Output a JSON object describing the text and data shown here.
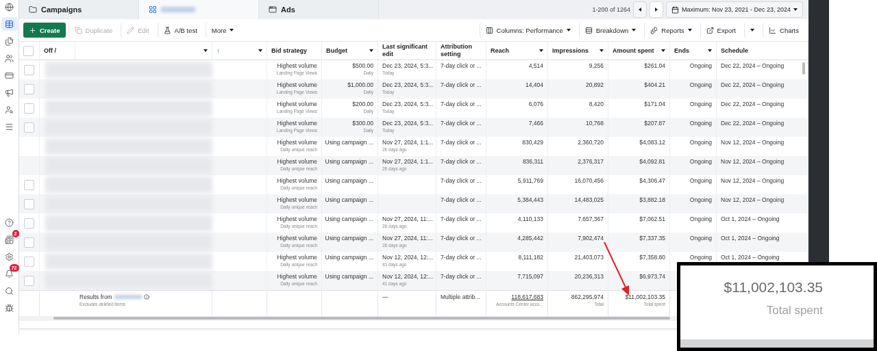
{
  "sidebar": {
    "items": [
      {
        "selected": false
      },
      {
        "selected": true
      },
      {
        "selected": false
      },
      {
        "selected": false
      },
      {
        "selected": false
      },
      {
        "selected": false
      },
      {
        "selected": false
      },
      {
        "selected": false
      }
    ],
    "bottom_items": [
      {
        "kind": "help"
      },
      {
        "kind": "news",
        "badge": "2"
      },
      {
        "kind": "settings"
      },
      {
        "kind": "bell",
        "badge": "72"
      },
      {
        "kind": "search"
      },
      {
        "kind": "bug"
      }
    ]
  },
  "tabs": [
    {
      "label": "Campaigns",
      "selected": false
    },
    {
      "selected": true
    },
    {
      "label": "Ads",
      "selected": false
    }
  ],
  "pagination": {
    "range": "1-200 of 1264"
  },
  "date_range": "Maximum: Nov 23, 2021 - Dec 23, 2024",
  "toolbar_left": [
    {
      "label": "Create",
      "kind": "primary",
      "disabled": false
    },
    {
      "label": "Duplicate",
      "kind": "plain",
      "disabled": true
    },
    {
      "label": "Edit",
      "kind": "plain",
      "disabled": true
    },
    {
      "label": "A/B test",
      "kind": "plain",
      "disabled": false
    },
    {
      "label": "More",
      "kind": "menu",
      "disabled": false
    }
  ],
  "toolbar_right": [
    {
      "label": "Columns: Performance",
      "kind": "menu"
    },
    {
      "label": "Breakdown",
      "kind": "menu"
    },
    {
      "label": "Reports",
      "kind": "menu"
    },
    {
      "label": "Export",
      "kind": "plain"
    },
    {
      "kind": "caret"
    },
    {
      "label": "Charts",
      "kind": "plain"
    }
  ],
  "table": {
    "header_checkbox": {
      "checked": false
    },
    "columns": [
      {
        "label": "Off /",
        "caret": false
      },
      {
        "caret": true
      },
      {
        "sort_mark": "↑",
        "caret": true
      },
      {
        "label": "Bid strategy",
        "caret": false
      },
      {
        "label": "Budget",
        "caret": true
      },
      {
        "label": "Last significant edit",
        "caret": false
      },
      {
        "label": "Attribution setting",
        "caret": false
      },
      {
        "label": "Reach",
        "caret": true
      },
      {
        "label": "Impressions",
        "caret": true
      },
      {
        "label": "Amount spent",
        "caret": true
      },
      {
        "label": "Ends",
        "caret": true
      },
      {
        "label": "Schedule",
        "caret": false
      }
    ],
    "rows": [
      {
        "checked": false,
        "bid": "Highest volume",
        "bid_note": "Landing Page Views",
        "budget": "$500.00",
        "budget_note": "Daily",
        "edit": "Dec 23, 2024, 5:3...",
        "edit_note": "Today",
        "attribution": "7-day click or ...",
        "reach": "4,514",
        "impressions": "9,256",
        "spent": "$261.04",
        "ends": "Ongoing",
        "schedule": "Dec 22, 2024 – Ongoing"
      },
      {
        "checked": false,
        "bid": "Highest volume",
        "bid_note": "Landing Page Views",
        "budget": "$1,000.00",
        "budget_note": "Daily",
        "edit": "Dec 23, 2024, 5:3...",
        "edit_note": "Today",
        "attribution": "7-day click or ...",
        "reach": "14,404",
        "impressions": "20,892",
        "spent": "$404.21",
        "ends": "Ongoing",
        "schedule": "Dec 22, 2024 – Ongoing"
      },
      {
        "checked": false,
        "bid": "Highest volume",
        "bid_note": "Landing Page Views",
        "budget": "$200.00",
        "budget_note": "Daily",
        "edit": "Dec 23, 2024, 5:3...",
        "edit_note": "Today",
        "attribution": "7-day click or ...",
        "reach": "6,076",
        "impressions": "8,420",
        "spent": "$171.04",
        "ends": "Ongoing",
        "schedule": "Dec 22, 2024 – Ongoing"
      },
      {
        "checked": false,
        "bid": "Highest volume",
        "bid_note": "Landing Page Views",
        "budget": "$300.00",
        "budget_note": "Daily",
        "edit": "Dec 23, 2024, 5:3...",
        "edit_note": "Today",
        "attribution": "7-day click or ...",
        "reach": "7,466",
        "impressions": "10,768",
        "spent": "$207.87",
        "ends": "Ongoing",
        "schedule": "Dec 22, 2024 – Ongoing"
      },
      {
        "bid": "Highest volume",
        "bid_note": "Daily unique reach",
        "budget": "Using campaign ...",
        "edit": "Nov 27, 2024, 1:1...",
        "edit_note": "26 days ago",
        "attribution": "7-day click or ...",
        "reach": "830,429",
        "impressions": "2,360,720",
        "spent": "$4,083.12",
        "ends": "Ongoing",
        "schedule": "Nov 12, 2024 – Ongoing"
      },
      {
        "bid": "Highest volume",
        "bid_note": "Daily unique reach",
        "budget": "Using campaign ...",
        "edit": "Nov 27, 2024, 1:1...",
        "edit_note": "26 days ago",
        "attribution": "7-day click or ...",
        "reach": "836,311",
        "impressions": "2,376,317",
        "spent": "$4,092.81",
        "ends": "Ongoing",
        "schedule": "Nov 12, 2024 – Ongoing"
      },
      {
        "checked": false,
        "bid": "Highest volume",
        "bid_note": "Daily unique reach",
        "budget": "Using campaign ...",
        "attribution": "7-day click or ...",
        "reach": "5,911,769",
        "impressions": "16,070,456",
        "spent": "$4,306.47",
        "ends": "Ongoing",
        "schedule": "Nov 12, 2024 – Ongoing"
      },
      {
        "checked": false,
        "bid": "Highest volume",
        "bid_note": "Daily unique reach",
        "budget": "Using campaign ...",
        "attribution": "7-day click or ...",
        "reach": "5,384,443",
        "impressions": "14,483,025",
        "spent": "$3,882.18",
        "ends": "Ongoing",
        "schedule": "Nov 12, 2024 – Ongoing"
      },
      {
        "checked": false,
        "bid": "Highest volume",
        "bid_note": "Daily unique reach",
        "budget": "Using campaign ...",
        "edit": "Nov 27, 2024, 11:...",
        "edit_note": "26 days ago",
        "attribution": "7-day click or ...",
        "reach": "4,110,133",
        "impressions": "7,657,367",
        "spent": "$7,062.51",
        "ends": "Ongoing",
        "schedule": "Oct 1, 2024 – Ongoing"
      },
      {
        "checked": false,
        "bid": "Highest volume",
        "bid_note": "Daily unique reach",
        "budget": "Using campaign ...",
        "edit": "Nov 27, 2024, 11:...",
        "edit_note": "26 days ago",
        "attribution": "7-day click or ...",
        "reach": "4,285,442",
        "impressions": "7,902,474",
        "spent": "$7,337.35",
        "ends": "Ongoing",
        "schedule": "Oct 1, 2024 – Ongoing"
      },
      {
        "checked": false,
        "bid": "Highest volume",
        "bid_note": "Daily unique reach",
        "budget": "Using campaign ...",
        "edit": "Nov 12, 2024, 12:...",
        "edit_note": "41 days ago",
        "attribution": "7-day click or ...",
        "reach": "8,111,182",
        "impressions": "21,403,073",
        "spent": "$7,358.80",
        "ends": "Ongoing",
        "schedule": "Oct 1, 2024 – Ongoing"
      },
      {
        "checked": false,
        "bid": "Highest volume",
        "bid_note": "Daily unique reach",
        "budget": "Using campaign ...",
        "edit": "Nov 12, 2024, 12:...",
        "edit_note": "41 days ago",
        "attribution": "7-day click or ...",
        "reach": "7,715,097",
        "impressions": "20,236,313",
        "spent": "$6,973.74"
      }
    ],
    "footer": {
      "results": "Results from",
      "results_note": "Excludes deleted items",
      "edit": "—",
      "attribution": "Multiple attrib...",
      "reach": "118,617,683",
      "reach_note": "Accounts Center acco...",
      "impressions": "862,295,974",
      "impressions_note": "Total",
      "spent": "$11,002,103.35",
      "spent_note": "Total spent"
    }
  },
  "callout": {
    "value": "$11,002,103.35",
    "label": "Total spent"
  }
}
